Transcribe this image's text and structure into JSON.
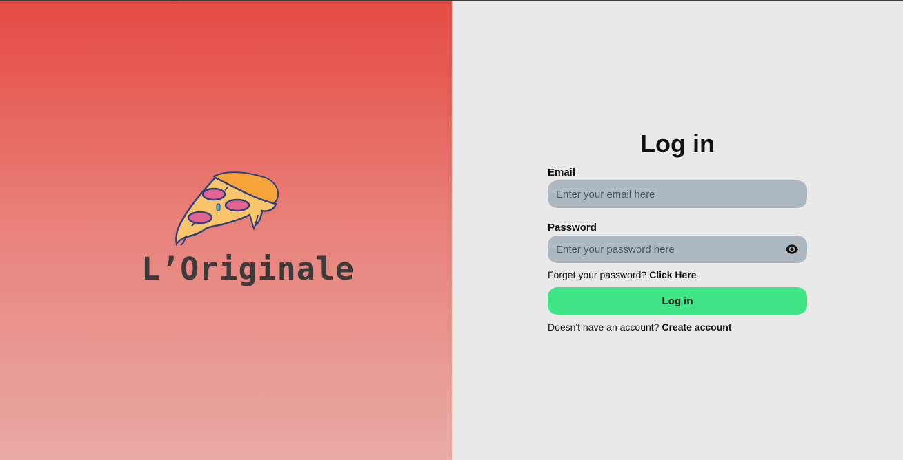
{
  "brand": {
    "name": "L’Originale"
  },
  "login": {
    "title": "Log in",
    "email_label": "Email",
    "email_placeholder": "Enter your email here",
    "password_label": "Password",
    "password_placeholder": "Enter your password here",
    "forgot_text": "Forget your password?",
    "forgot_link": "Click Here",
    "submit_label": "Log in",
    "no_account_text": "Doesn't have an account?",
    "create_account_link": "Create account"
  },
  "colors": {
    "left_top": "#e54a42",
    "left_bottom": "#e8aaa5",
    "right_bg": "#e9e9e9",
    "input_bg": "#adb8c1",
    "button_bg": "#3fe585"
  },
  "icons": {
    "logo": "pizza-slice-icon",
    "password_toggle": "eye-icon"
  }
}
